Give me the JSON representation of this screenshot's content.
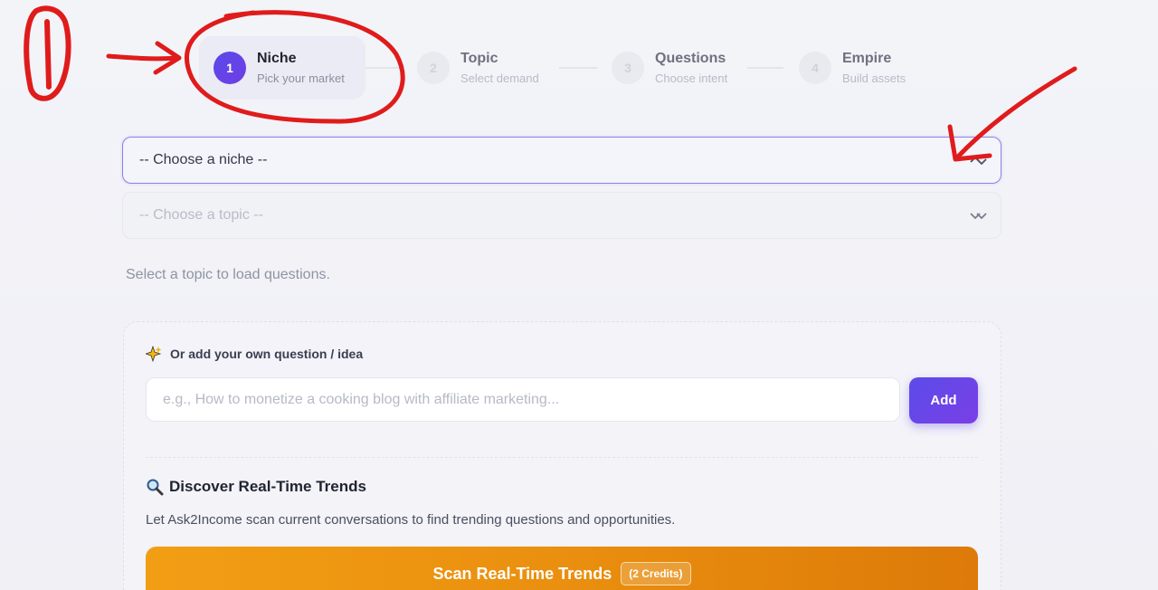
{
  "stepper": {
    "steps": [
      {
        "number": "1",
        "title": "Niche",
        "subtitle": "Pick your market"
      },
      {
        "number": "2",
        "title": "Topic",
        "subtitle": "Select demand"
      },
      {
        "number": "3",
        "title": "Questions",
        "subtitle": "Choose intent"
      },
      {
        "number": "4",
        "title": "Empire",
        "subtitle": "Build assets"
      }
    ],
    "active_step": 1
  },
  "niche_select": {
    "value": "-- Choose a niche --",
    "icon": "chevron-up-down-icon"
  },
  "topic_select": {
    "value": "-- Choose a topic --",
    "icon": "chevron-up-down-icon"
  },
  "hint": "Select a topic to load questions.",
  "own_question": {
    "label": "Or add your own question / idea",
    "icon": "sparkles-icon",
    "placeholder": "e.g., How to monetize a cooking blog with affiliate marketing...",
    "add_label": "Add"
  },
  "trends": {
    "title": "Discover Real-Time Trends",
    "icon": "magnifier-icon",
    "description": "Let Ask2Income scan current conversations to find trending questions and opportunities.",
    "button_label": "Scan Real-Time Trends",
    "credits_badge": "(2 Credits)"
  },
  "annotation": {
    "number": "1",
    "color": "#e01b1b"
  },
  "colors": {
    "accent": "#5b4be9",
    "trend_button": "#ea8f0f",
    "annotation": "#e01b1b"
  }
}
